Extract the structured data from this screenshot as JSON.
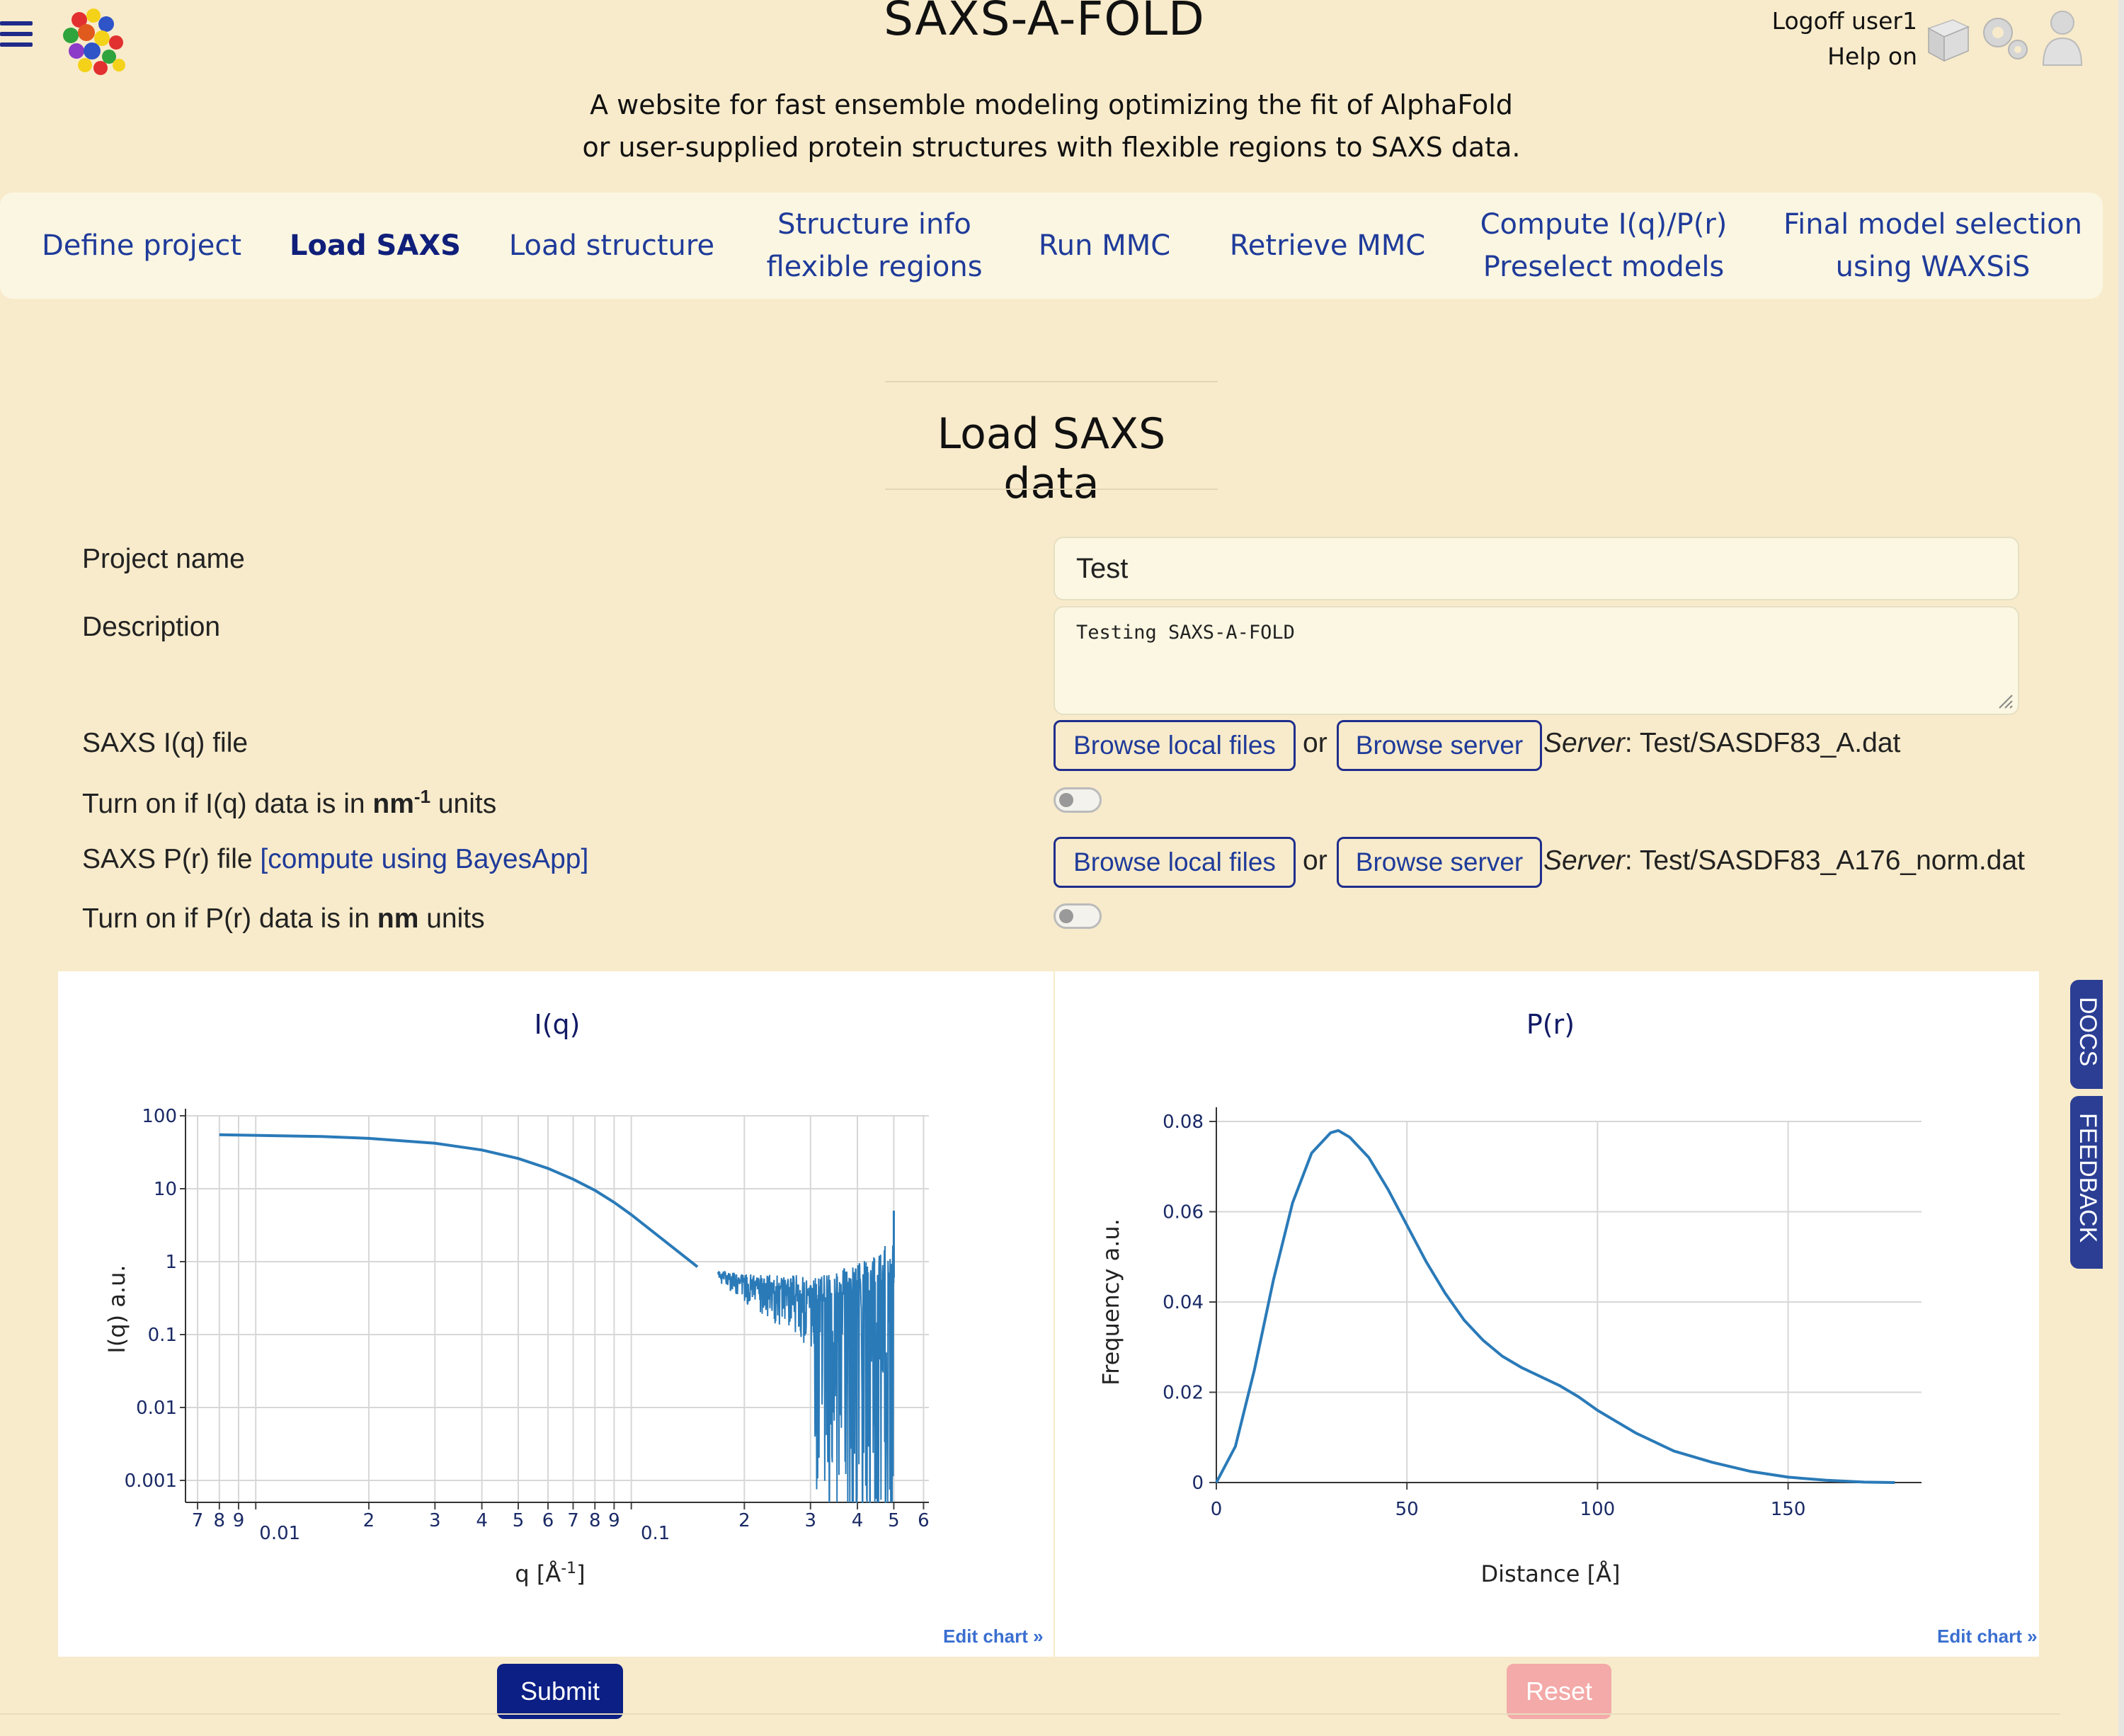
{
  "header": {
    "site_title": "SAXS-A-FOLD",
    "tagline_line1": "A website for fast ensemble modeling optimizing the fit of AlphaFold",
    "tagline_line2": "or user-supplied protein structures with flexible regions to SAXS data.",
    "logoff": "Logoff user1",
    "help": "Help on"
  },
  "nav": {
    "items": [
      {
        "line1": "Define project",
        "line2": ""
      },
      {
        "line1": "Load SAXS",
        "line2": ""
      },
      {
        "line1": "Load structure",
        "line2": ""
      },
      {
        "line1": "Structure info",
        "line2": "flexible regions"
      },
      {
        "line1": "Run MMC",
        "line2": ""
      },
      {
        "line1": "Retrieve MMC",
        "line2": ""
      },
      {
        "line1": "Compute I(q)/P(r)",
        "line2": "Preselect models"
      },
      {
        "line1": "Final model selection",
        "line2": "using WAXSiS"
      }
    ],
    "active_index": 1
  },
  "page": {
    "section_title": "Load SAXS data"
  },
  "form": {
    "project_name_label": "Project name",
    "project_name_value": "Test",
    "description_label": "Description",
    "description_value": "Testing SAXS-A-FOLD",
    "iq_file_label": "SAXS I(q) file",
    "browse_local": "Browse local files",
    "or": "or",
    "browse_server": "Browse server",
    "server_label": "Server",
    "iq_server_file": ": Test/SASDF83_A.dat",
    "iq_nm_label_pre": "Turn on if I(q) data is in ",
    "iq_nm_unit": "nm",
    "iq_nm_exp": "-1",
    "iq_nm_label_post": " units",
    "iq_nm_on": false,
    "pr_file_label": "SAXS P(r) file ",
    "pr_compute_link": "[compute using BayesApp]",
    "pr_server_file": ": Test/SASDF83_A176_norm.dat",
    "pr_nm_label_pre": "Turn on if P(r) data is in ",
    "pr_nm_unit": "nm",
    "pr_nm_label_post": " units",
    "pr_nm_on": false
  },
  "chart_data": [
    {
      "type": "line",
      "title": "I(q)",
      "xlabel": "q [Å",
      "xlabel_exp": "-1",
      "xlabel_end": "]",
      "ylabel": "I(q) a.u.",
      "xscale": "log",
      "yscale": "log",
      "xlim": [
        0.0065,
        0.62
      ],
      "ylim": [
        0.0005,
        100
      ],
      "grid": true,
      "x_tick_labels": [
        "7",
        "8",
        "9",
        "0.01",
        "2",
        "3",
        "4",
        "5",
        "6",
        "7",
        "8",
        "9",
        "0.1",
        "2",
        "3",
        "4",
        "5",
        "6"
      ],
      "x_tick_values": [
        0.007,
        0.008,
        0.009,
        0.01,
        0.02,
        0.03,
        0.04,
        0.05,
        0.06,
        0.07,
        0.08,
        0.09,
        0.1,
        0.2,
        0.3,
        0.4,
        0.5,
        0.6
      ],
      "y_tick_labels": [
        "100",
        "10",
        "1",
        "0.1",
        "0.01",
        "0.001"
      ],
      "y_tick_values": [
        100,
        10,
        1,
        0.1,
        0.01,
        0.001
      ],
      "x": [
        0.008,
        0.01,
        0.015,
        0.02,
        0.03,
        0.04,
        0.05,
        0.06,
        0.07,
        0.08,
        0.09,
        0.1,
        0.12,
        0.15,
        0.2,
        0.25,
        0.3,
        0.35,
        0.4,
        0.45,
        0.5
      ],
      "y": [
        55,
        54,
        52,
        49,
        42,
        34,
        26,
        19,
        13.5,
        9.5,
        6.5,
        4.4,
        2.1,
        0.85,
        0.5,
        0.38,
        0.3,
        0.28,
        0.32,
        0.4,
        0.6
      ],
      "noisy_from_q": 0.17,
      "end_spike_y": 5
    },
    {
      "type": "line",
      "title": "P(r)",
      "xlabel": "Distance [Å]",
      "ylabel": "Frequency a.u.",
      "xlim": [
        0,
        185
      ],
      "ylim": [
        0,
        0.08
      ],
      "grid": true,
      "x_tick_values": [
        0,
        50,
        100,
        150
      ],
      "x_tick_labels": [
        "0",
        "50",
        "100",
        "150"
      ],
      "y_tick_values": [
        0,
        0.02,
        0.04,
        0.06,
        0.08
      ],
      "y_tick_labels": [
        "0",
        "0.02",
        "0.04",
        "0.06",
        "0.08"
      ],
      "x": [
        0,
        5,
        10,
        15,
        20,
        25,
        30,
        32,
        35,
        40,
        45,
        50,
        55,
        60,
        65,
        70,
        75,
        80,
        85,
        90,
        95,
        100,
        110,
        120,
        130,
        140,
        150,
        160,
        170,
        178
      ],
      "y": [
        0,
        0.008,
        0.025,
        0.045,
        0.062,
        0.073,
        0.0775,
        0.078,
        0.0765,
        0.072,
        0.065,
        0.057,
        0.049,
        0.042,
        0.036,
        0.0315,
        0.028,
        0.0255,
        0.0235,
        0.0215,
        0.019,
        0.016,
        0.011,
        0.007,
        0.0045,
        0.0025,
        0.0012,
        0.0005,
        0.0001,
        0
      ]
    }
  ],
  "charts": {
    "edit_chart_label": "Edit chart »"
  },
  "side_tabs": {
    "docs": "DOCS",
    "feedback": "FEEDBACK"
  },
  "buttons": {
    "submit": "Submit",
    "reset": "Reset"
  },
  "colors": {
    "background": "#f8ebcb",
    "nav_text": "#1f3b9a",
    "line": "#2a7ab8",
    "submit_bg": "#0b1f84",
    "reset_bg": "#f3aaa8"
  }
}
